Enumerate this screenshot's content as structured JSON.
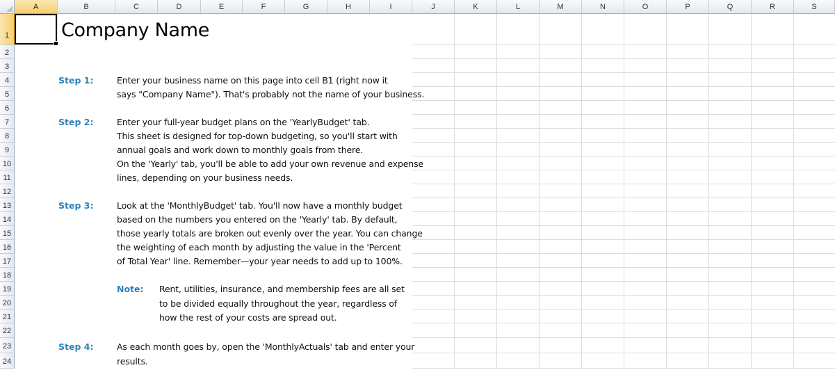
{
  "columns": [
    "A",
    "B",
    "C",
    "D",
    "E",
    "F",
    "G",
    "H",
    "I",
    "J",
    "K",
    "L",
    "M",
    "N",
    "O",
    "P",
    "Q",
    "R",
    "S"
  ],
  "rows": [
    "1",
    "2",
    "3",
    "4",
    "5",
    "6",
    "7",
    "8",
    "9",
    "10",
    "11",
    "12",
    "13",
    "14",
    "15",
    "16",
    "17",
    "18",
    "19",
    "20",
    "21",
    "22",
    "23",
    "24"
  ],
  "title": "Company Name",
  "steps": {
    "step1_label": "Step 1:",
    "step1_line1": "Enter your business name on this page into cell B1 (right now it",
    "step1_line2": "says \"Company Name\"). That's probably not the name of your business.",
    "step2_label": "Step 2:",
    "step2_line1": "Enter your full-year budget plans on the 'YearlyBudget' tab.",
    "step2_line2": "This sheet is designed for top-down budgeting, so you'll start with",
    "step2_line3": "annual goals and work down to monthly goals from there.",
    "step2_line4": "On the 'Yearly' tab, you'll be able to add your own revenue and expense",
    "step2_line5": "lines, depending on your business needs.",
    "step3_label": "Step 3:",
    "step3_line1": "Look at the 'MonthlyBudget' tab. You'll now have a monthly budget",
    "step3_line2": "based on the numbers you entered on the 'Yearly' tab. By default,",
    "step3_line3": "those yearly totals are broken out evenly over the year. You can change",
    "step3_line4": "the weighting of each month by adjusting the value in the 'Percent",
    "step3_line5": "of Total Year' line. Remember—your year needs to add up to 100%.",
    "note_label": "Note:",
    "note_line1": "Rent, utilities, insurance, and membership fees are all set",
    "note_line2": "to be divided equally throughout the year, regardless of",
    "note_line3": "how the rest of your costs are spread out.",
    "step4_label": "Step 4:",
    "step4_line1": "As each month goes by, open the 'MonthlyActuals' tab and enter your",
    "step4_line2": "results."
  },
  "colors": {
    "accent": "#2e82b8",
    "selected_header": "#f5cf6e",
    "gridline": "#dadcdd"
  }
}
